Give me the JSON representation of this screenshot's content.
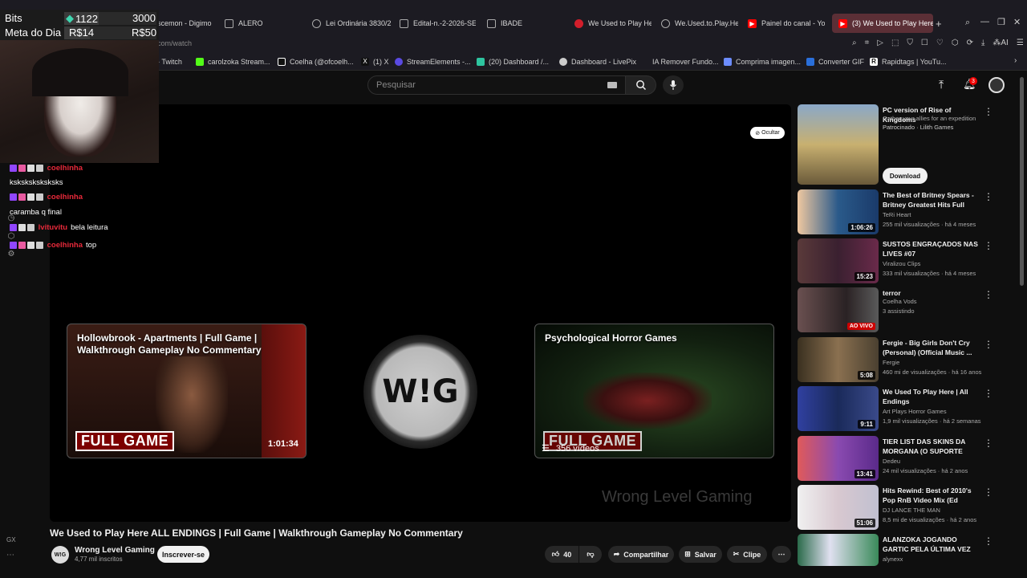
{
  "browser": {
    "tabs": [
      {
        "label": "scemon - Digimo",
        "icon_color": "#555555"
      },
      {
        "label": "ALERO",
        "icon_color": "#666666"
      },
      {
        "label": "Lei Ordinária 3830/2",
        "icon_color": "#666666"
      },
      {
        "label": "Edital-n.-2-2026-SE",
        "icon_color": "#666666"
      },
      {
        "label": "IBADE",
        "icon_color": "#666666"
      },
      {
        "label": "We Used to Play Here",
        "icon_color": "#d21e2b"
      },
      {
        "label": "We.Used.to.Play.Here",
        "icon_color": "#777777"
      },
      {
        "label": "Painel do canal - You",
        "icon_color": "#ff0000"
      },
      {
        "label": "(3) We Used to Play Here",
        "icon_color": "#ff0000",
        "active": true
      }
    ],
    "url": "www.youtube.com/watch",
    "bookmarks": [
      {
        "label": "- Twitch",
        "color": "#9146ff"
      },
      {
        "label": "carolzoka Stream...",
        "color": "#53fc18"
      },
      {
        "label": "Coelha (@ofcoelh...",
        "color": "#111111"
      },
      {
        "label": "(1) X",
        "color": "#111111"
      },
      {
        "label": "StreamElements -...",
        "color": "#5a4ae3"
      },
      {
        "label": "(20) Dashboard /...",
        "color": "#2ec4a0"
      },
      {
        "label": "Dashboard - LivePix",
        "color": "#cccccc"
      },
      {
        "label": "IA Remover Fundo...",
        "color": "#888888"
      },
      {
        "label": "Comprima imagen...",
        "color": "#6c8cff"
      },
      {
        "label": "Converter GIF",
        "color": "#2a6fdb"
      },
      {
        "label": "Rapidtags | YouTu...",
        "color": "#ffffff"
      }
    ]
  },
  "youtube": {
    "search_placeholder": "Pesquisar",
    "notification_count": "3",
    "player": {
      "hide_label": "Ocultar",
      "end_cards": [
        {
          "title": "Hollowbrook - Apartments | Full Game | Walkthrough Gameplay No Commentary",
          "badge": "FULL GAME",
          "duration": "1:01:34"
        },
        {
          "title": "Psychological Horror Games",
          "badge": "FULL GAME",
          "video_count": "356 vídeos"
        }
      ],
      "logo_text": "W!G",
      "watermark": "Wrong Level Gaming"
    },
    "video": {
      "title": "We Used to Play Here ALL ENDINGS | Full Game | Walkthrough Gameplay No Commentary",
      "channel": "Wrong Level Gaming",
      "subscribers": "4,77 mil inscritos",
      "subscribe": "Inscrever-se",
      "likes": "40",
      "share": "Compartilhar",
      "save": "Salvar",
      "clip": "Clipe"
    },
    "recommendations": [
      {
        "title": "PC version of Rise of Kingdoms",
        "channel": "Gather your allies for an expedition",
        "meta": "Patrocinado · Lilith Games",
        "cta": "Download",
        "thumb": "#6a8bb0"
      },
      {
        "title": "The Best of Britney Spears - Britney Greatest Hits Full Albu...",
        "channel": "TeRi Heart",
        "meta": "255 mil visualizações · há 4 meses",
        "duration": "1:06:26",
        "thumb": "#2a5a8a"
      },
      {
        "title": "SUSTOS ENGRAÇADOS NAS LIVES #07",
        "channel": "Viralizou Clips",
        "meta": "333 mil visualizações · há 4 meses",
        "duration": "15:23",
        "thumb": "#4a2c3a"
      },
      {
        "title": "terror",
        "channel": "Coelha Vods",
        "meta": "3 assistindo",
        "live": "AO VIVO",
        "thumb": "#3a3234"
      },
      {
        "title": "Fergie - Big Girls Don't Cry (Personal) (Official Music ...",
        "channel": "Fergie",
        "meta": "460 mi de visualizações · há 16 anos",
        "duration": "5:08",
        "thumb": "#6a5a3a"
      },
      {
        "title": "We Used To Play Here | All Endings",
        "channel": "Art Plays Horror Games",
        "meta": "1,9 mil visualizações · há 2 semanas",
        "duration": "9:11",
        "thumb": "#2a3a6a"
      },
      {
        "title": "TIER LIST DAS SKINS DA MORGANA (O SUPORTE MAIS...",
        "channel": "Dedeu",
        "meta": "24 mil visualizações · há 2 anos",
        "duration": "13:41",
        "thumb": "#6a3a8a"
      },
      {
        "title": "Hits Rewind: Best of 2010's Pop RnB Video Mix (Ed Sheeran, Ri...",
        "channel": "DJ LANCE THE MAN",
        "meta": "8,5 mi de visualizações · há 2 anos",
        "duration": "51:06",
        "thumb": "#c8c8d8"
      },
      {
        "title": "ALANZOKA JOGANDO GARTIC PELA ÚLTIMA VEZ",
        "channel": "alynexx",
        "meta": "",
        "thumb": "#3a8a5a"
      }
    ]
  },
  "overlay": {
    "bits_label": "Bits",
    "bits_value": "1122",
    "bits_goal": "3000",
    "meta_label": "Meta do Dia",
    "meta_value": "R$14",
    "meta_goal": "R$50",
    "chat": [
      {
        "user": "coelhinha",
        "message": "ksksksksksksks"
      },
      {
        "user": "coelhinha",
        "message": "caramba q final"
      },
      {
        "user": "lvituvitu",
        "message": "bela leitura"
      },
      {
        "user": "coelhinha",
        "message": "top"
      }
    ],
    "gx_label": "GX"
  }
}
